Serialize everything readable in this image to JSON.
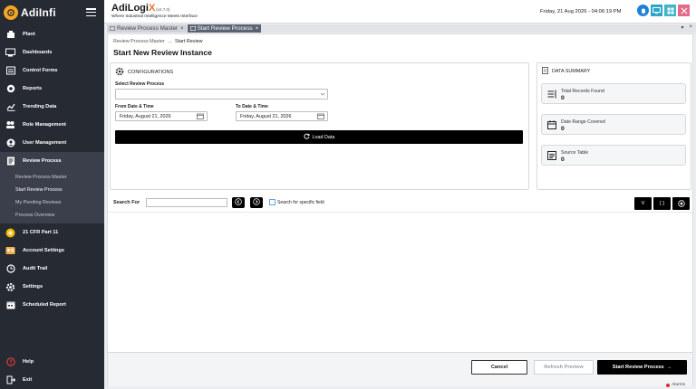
{
  "brand": {
    "name": "AdiInfi"
  },
  "sidebar": {
    "items": [
      {
        "label": "Plant",
        "icon": "plant-icon"
      },
      {
        "label": "Dashboards",
        "icon": "dashboard-icon"
      },
      {
        "label": "Control Forms",
        "icon": "form-icon"
      },
      {
        "label": "Reports",
        "icon": "report-icon"
      },
      {
        "label": "Trending Data",
        "icon": "trend-icon"
      },
      {
        "label": "Role Management",
        "icon": "role-icon"
      },
      {
        "label": "User Management",
        "icon": "user-icon"
      },
      {
        "label": "Review Process",
        "icon": "review-icon"
      }
    ],
    "submenu": [
      "Review Process Master",
      "Start Review Process",
      "My Pending Reviews",
      "Process Overview"
    ],
    "items_after": [
      {
        "label": "21 CFR Part 11",
        "icon": "cfr-icon"
      },
      {
        "label": "Account Settings",
        "icon": "account-icon"
      },
      {
        "label": "Audit Trail",
        "icon": "audit-icon"
      },
      {
        "label": "Settings",
        "icon": "settings-icon"
      },
      {
        "label": "Scheduled Report",
        "icon": "schedule-icon"
      }
    ],
    "bottom": [
      {
        "label": "Help",
        "icon": "help-icon"
      },
      {
        "label": "Exit",
        "icon": "exit-icon"
      }
    ]
  },
  "header": {
    "app_name_1": "AdiLogi",
    "app_name_2": "X",
    "version": "(v2.7.0)",
    "tagline": "Where Industrial Intelligence Meets Interface",
    "datetime": "Friday, 21 Aug 2026 - 04:06:19 PM"
  },
  "tabs": [
    {
      "label": "Review Process Master",
      "active": false
    },
    {
      "label": "Start Review Process",
      "active": true
    }
  ],
  "breadcrumb": {
    "parent": "Review Process Master",
    "current": "Start Review"
  },
  "page_title": "Start New Review Instance",
  "config": {
    "title": "CONFIGURATIONS",
    "select_label": "Select Review Process",
    "select_value": "",
    "from_label": "From Date & Time",
    "from_value": "Friday, August 21, 2026",
    "to_label": "To Date & Time",
    "to_value": "Friday, August 21, 2026",
    "load_label": "Load Data"
  },
  "summary": {
    "title": "DATA SUMMARY",
    "items": [
      {
        "label": "Total Records Found",
        "value": "0"
      },
      {
        "label": "Date Range Covered",
        "value": "0"
      },
      {
        "label": "Source Table",
        "value": "0"
      }
    ]
  },
  "search": {
    "label": "Search For",
    "value": "",
    "specific_label": "Search for specific field",
    "btn_v": "V",
    "btn_brackets": "[ ]"
  },
  "footer": {
    "cancel": "Cancel",
    "refresh": "Refresh Preview",
    "start": "Start Review Process"
  },
  "status": {
    "alarms": "Alarms"
  }
}
